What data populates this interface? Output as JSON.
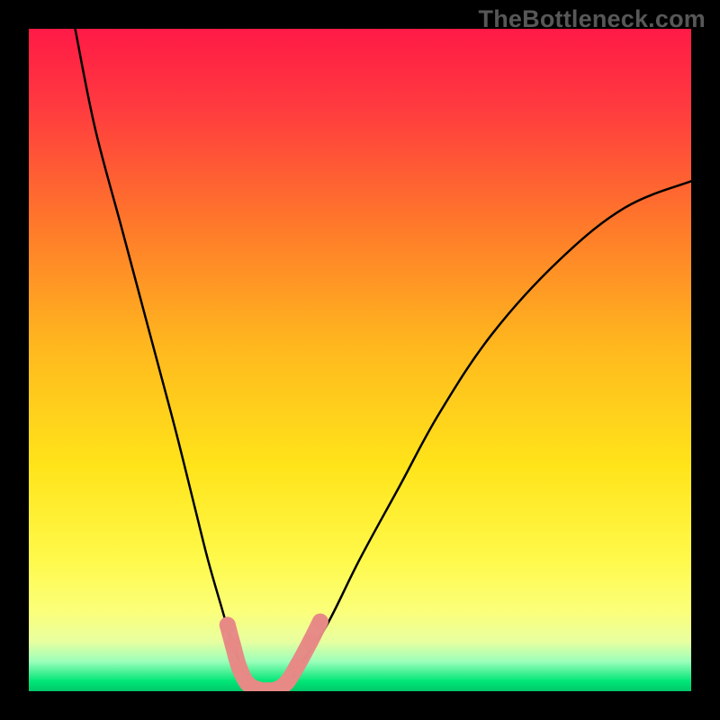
{
  "watermark": "TheBottleneck.com",
  "chart_data": {
    "type": "line",
    "title": "",
    "xlabel": "",
    "ylabel": "",
    "xlim": [
      0,
      100
    ],
    "ylim": [
      0,
      100
    ],
    "grid": false,
    "legend": false,
    "background_gradient": {
      "top_color": "#ff1a46",
      "mid_color": "#ffe400",
      "bottom_color": "#00e676",
      "bottom_band_start": 93
    },
    "series": [
      {
        "name": "bottleneck-curve",
        "color": "#000000",
        "x": [
          7,
          10,
          14,
          18,
          22,
          25,
          27,
          29,
          30.5,
          32,
          33.5,
          35,
          37,
          39,
          41,
          45,
          50,
          56,
          62,
          70,
          80,
          90,
          100
        ],
        "y": [
          100,
          85,
          70,
          55,
          40,
          28,
          20,
          13,
          8,
          4,
          1,
          0,
          0,
          1,
          4,
          10,
          20,
          31,
          42,
          54,
          65,
          73,
          77
        ]
      }
    ],
    "markers": {
      "name": "highlighted-segment",
      "color": "#e78a86",
      "radius_px": 9,
      "points": [
        {
          "x": 30.0,
          "y": 10.0
        },
        {
          "x": 30.8,
          "y": 7.0
        },
        {
          "x": 31.8,
          "y": 3.5
        },
        {
          "x": 33.0,
          "y": 1.2
        },
        {
          "x": 34.5,
          "y": 0.3
        },
        {
          "x": 36.0,
          "y": 0.1
        },
        {
          "x": 37.5,
          "y": 0.3
        },
        {
          "x": 39.0,
          "y": 1.4
        },
        {
          "x": 40.5,
          "y": 3.8
        },
        {
          "x": 42.5,
          "y": 7.5
        },
        {
          "x": 44.0,
          "y": 10.5
        }
      ]
    }
  }
}
